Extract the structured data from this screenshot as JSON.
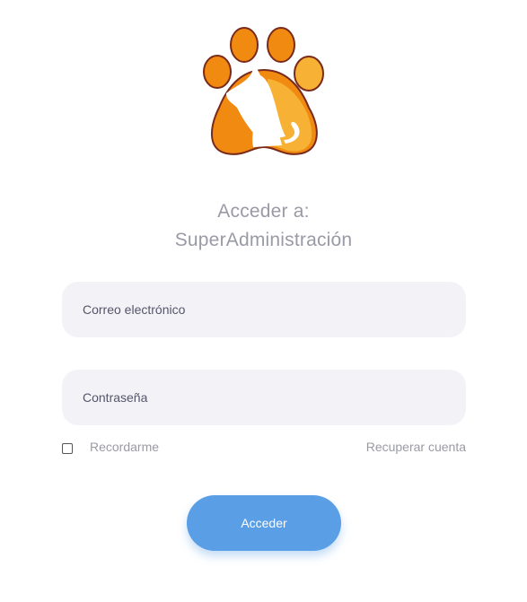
{
  "logo": {
    "icon": "paw-dog-cat-logo-icon",
    "colors": {
      "orange": "#f08a10",
      "light_orange": "#f7b135",
      "outline": "#7a2a1a",
      "white": "#ffffff"
    }
  },
  "heading": {
    "line1": "Acceder a:",
    "line2": "SuperAdministración"
  },
  "form": {
    "email_placeholder": "Correo electrónico",
    "password_placeholder": "Contraseña",
    "remember_label": "Recordarme",
    "remember_checked": false,
    "recover_link": "Recuperar cuenta",
    "submit_label": "Acceder"
  },
  "colors": {
    "field_bg": "#f3f2f7",
    "muted_text": "#9a9aa6",
    "button_bg": "#5a9ee6"
  }
}
